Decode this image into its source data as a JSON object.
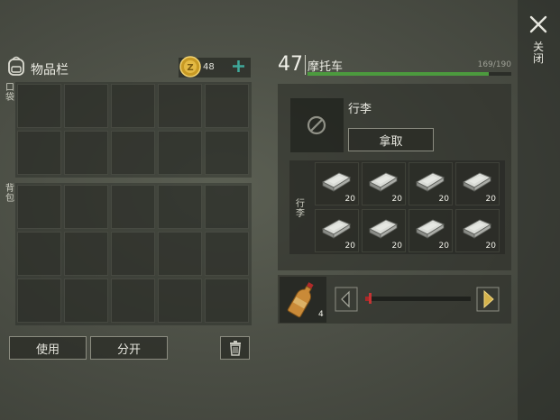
{
  "close": {
    "label": "关闭"
  },
  "inventory": {
    "title": "物品栏",
    "coins": "48",
    "pocket_label": "口袋",
    "backpack_label": "背包",
    "buttons": {
      "use": "使用",
      "split": "分开"
    }
  },
  "vehicle": {
    "level": "47",
    "name": "摩托车",
    "hp_text": "169/190",
    "hp_fraction": 0.889
  },
  "trunk": {
    "title": "行李",
    "take_button": "拿取",
    "side_label": "行李",
    "items": [
      {
        "icon": "metal-ingot-icon",
        "qty": "20"
      },
      {
        "icon": "metal-ingot-icon",
        "qty": "20"
      },
      {
        "icon": "metal-ingot-icon",
        "qty": "20"
      },
      {
        "icon": "metal-ingot-icon",
        "qty": "20"
      },
      {
        "icon": "metal-ingot-icon",
        "qty": "20"
      },
      {
        "icon": "metal-ingot-icon",
        "qty": "20"
      },
      {
        "icon": "metal-ingot-icon",
        "qty": "20"
      },
      {
        "icon": "metal-ingot-icon",
        "qty": "20"
      }
    ]
  },
  "fuel": {
    "item_icon": "fuel-bottle-icon",
    "qty": "4",
    "slider_fraction": 0.05
  },
  "colors": {
    "hp_bar": "#4c9a3e",
    "arrow_accent": "#d4b24a",
    "coin": "#d9b13a",
    "plus": "#3fa89a"
  }
}
